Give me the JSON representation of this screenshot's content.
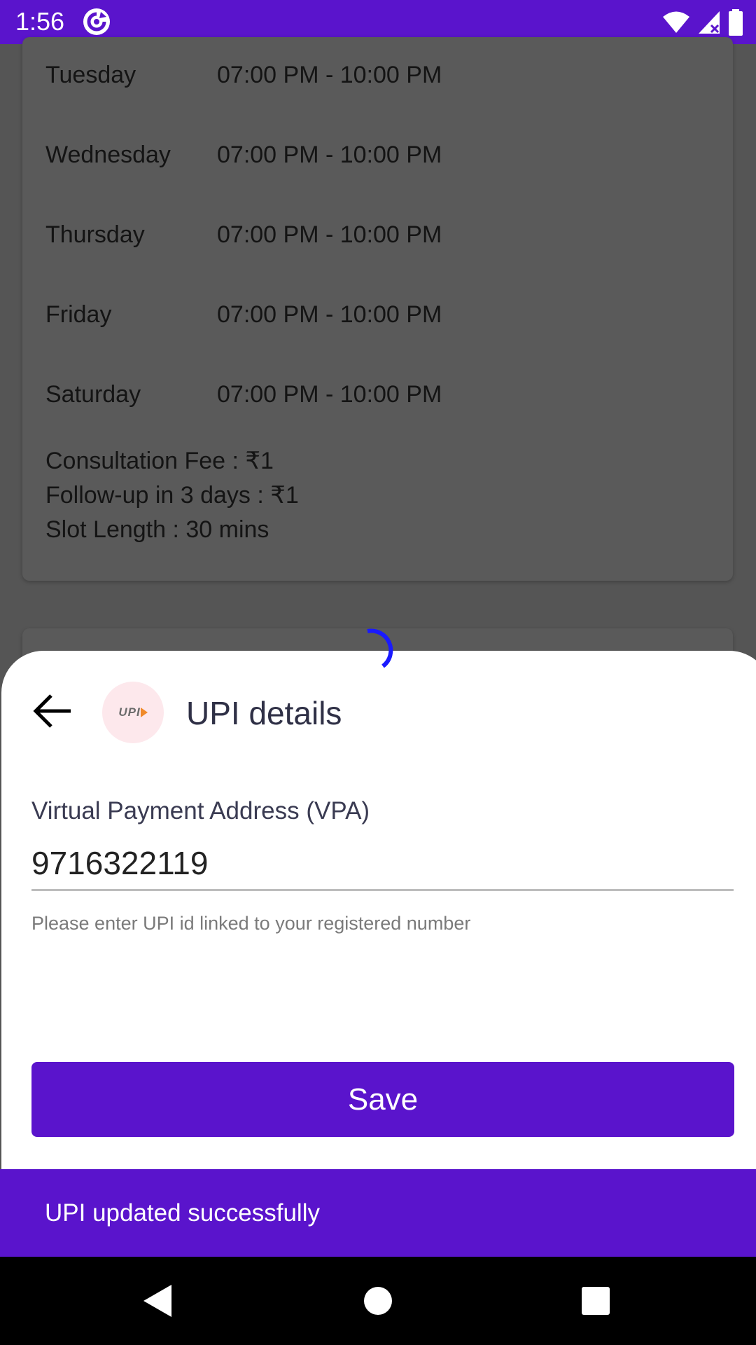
{
  "status_bar": {
    "time": "1:56",
    "app_icon": "sync-app-icon",
    "icons": [
      "wifi-icon",
      "signal-icon",
      "battery-icon"
    ]
  },
  "schedule": {
    "rows": [
      {
        "day": "Tuesday",
        "time": "07:00 PM - 10:00 PM"
      },
      {
        "day": "Wednesday",
        "time": "07:00 PM - 10:00 PM"
      },
      {
        "day": "Thursday",
        "time": "07:00 PM - 10:00 PM"
      },
      {
        "day": "Friday",
        "time": "07:00 PM - 10:00 PM"
      },
      {
        "day": "Saturday",
        "time": "07:00 PM - 10:00 PM"
      }
    ],
    "consultation_fee": "Consultation Fee : ₹1",
    "follow_up": "Follow-up in 3 days : ₹1",
    "slot_length": "Slot Length : 30 mins"
  },
  "sheet": {
    "title": "UPI details",
    "logo_text": "UPI",
    "vpa_label": "Virtual Payment Address (VPA)",
    "vpa_value": "9716322119",
    "helper": "Please enter UPI id linked to your registered number",
    "save_label": "Save"
  },
  "snackbar": {
    "message": "UPI updated successfully"
  },
  "colors": {
    "primary": "#5a14cc",
    "spinner": "#1a1aff",
    "logo_bg": "#fde8ec"
  }
}
